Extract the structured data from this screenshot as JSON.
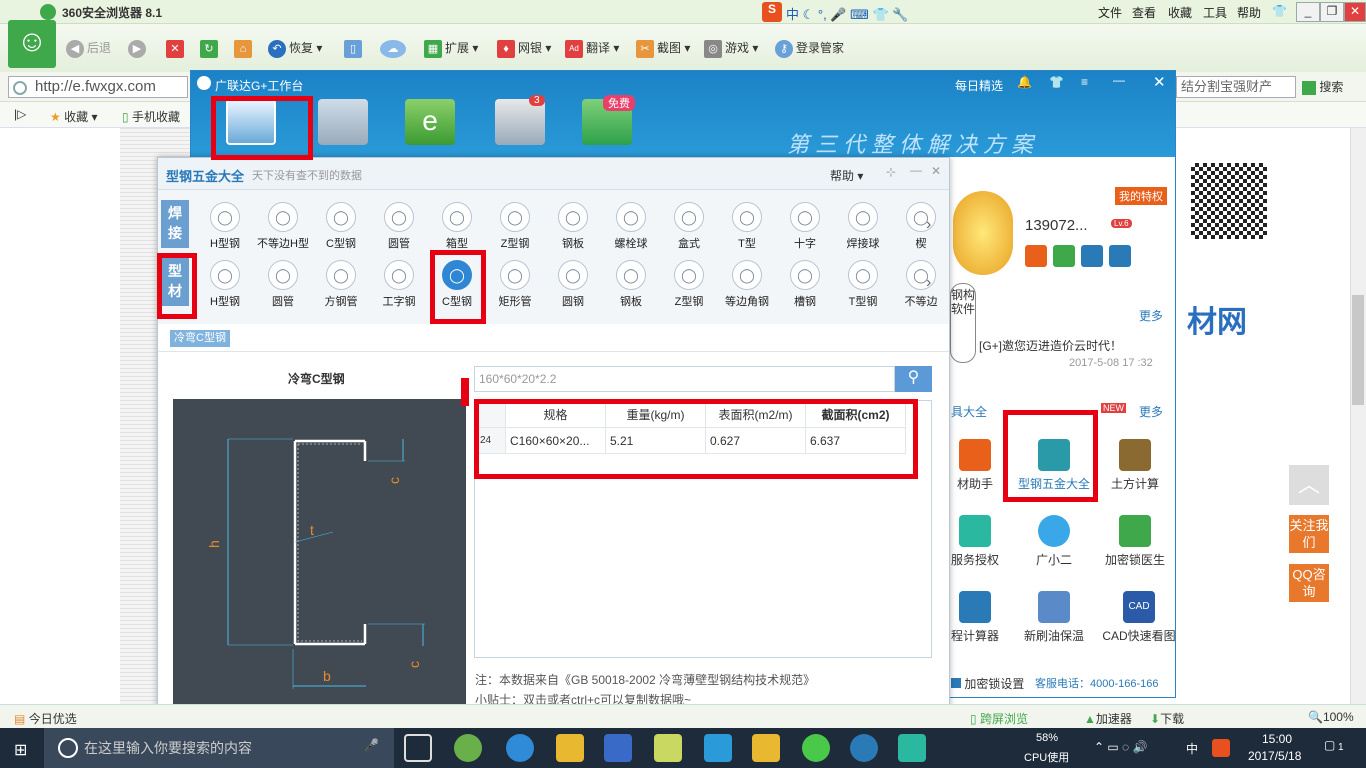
{
  "browser": {
    "title": "360安全浏览器 8.1",
    "menus": [
      "文件",
      "查看",
      "收藏",
      "工具",
      "帮助"
    ],
    "toolbar": [
      "后退",
      "恢复",
      "扩展",
      "网银",
      "翻译",
      "截图",
      "游戏",
      "登录管家"
    ],
    "address": "http://e.fwxgx.com",
    "search_placeholder": "结分割宝强财产",
    "search_button": "搜索",
    "bookmarks": [
      "收藏",
      "手机收藏"
    ],
    "status_left": "今日优选",
    "status_items": [
      "跨屏浏览",
      "加速器",
      "下载",
      "100%"
    ]
  },
  "workbench": {
    "title": "广联达G+工作台",
    "daily": "每日精选",
    "slogan": "第三代整体解决方案",
    "badge_count": "3",
    "badge_free": "免费",
    "user_id": "139072...",
    "privilege": "我的特权",
    "more1": "更多",
    "news": "[G+]邀您迈进造价云时代！",
    "news_date": "2017-5-08 17 :32",
    "section_suffix": "具大全",
    "more2": "更多",
    "tools": [
      {
        "label": "材助手"
      },
      {
        "label": "型钢五金大全"
      },
      {
        "label": "土方计算"
      },
      {
        "label": "服务授权"
      },
      {
        "label": "广小二"
      },
      {
        "label": "加密锁医生"
      },
      {
        "label": "程计算器"
      },
      {
        "label": "新刷油保温"
      },
      {
        "label": "CAD快速看图"
      }
    ],
    "footer_left": "加密锁设置",
    "footer_right": "客服电话：4000-166-166",
    "side_badge_text": "钢构软件"
  },
  "dialog": {
    "title": "型钢五金大全",
    "subtitle": "天下没有查不到的数据",
    "help": "帮助",
    "cat1": "焊接",
    "cat2": "型材",
    "row1": [
      "H型钢",
      "不等边H型",
      "C型钢",
      "圆管",
      "箱型",
      "Z型钢",
      "钢板",
      "螺栓球",
      "盒式",
      "T型",
      "十字",
      "焊接球",
      "楔"
    ],
    "row2": [
      "H型钢",
      "圆管",
      "方钢管",
      "工字钢",
      "C型钢",
      "矩形管",
      "圆钢",
      "钢板",
      "Z型钢",
      "等边角钢",
      "槽钢",
      "T型钢",
      "不等边"
    ],
    "breadcrumb": "冷弯C型钢",
    "diagram_title": "冷弯C型钢",
    "search_placeholder": "160*60*20*2.2",
    "table_headers": [
      "规格",
      "重量(kg/m)",
      "表面积(m2/m)",
      "截面积(cm2)"
    ],
    "table_row": {
      "idx": "24",
      "spec": "C160×60×20...",
      "weight": "5.21",
      "surface": "0.627",
      "area": "6.637"
    },
    "note1": "注：本数据来自《GB 50018-2002 冷弯薄壁型钢结构技术规范》",
    "note2": "小贴士：双击或者ctrl+c可以复制数据哦~",
    "dim_labels": {
      "h": "h",
      "t": "t",
      "b": "b",
      "c": "c"
    }
  },
  "side": {
    "follow": "关注我们",
    "qq": "QQ咨询"
  },
  "taskbar": {
    "search": "在这里输入你要搜索的内容",
    "cpu": "58%",
    "cpu_label": "CPU使用",
    "ime": "中",
    "time": "15:00",
    "date": "2017/5/18",
    "notif": "1"
  }
}
